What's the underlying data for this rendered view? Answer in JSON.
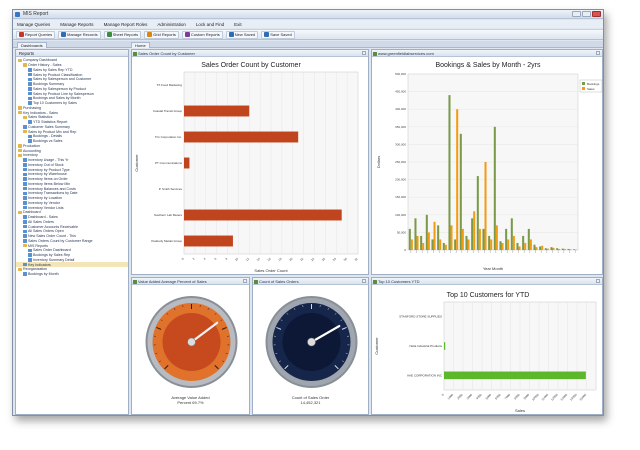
{
  "window": {
    "title": "MIS Report"
  },
  "menu": [
    "Manage Queries",
    "Manage Reports",
    "Manage Report Roles",
    "Administration",
    "Lock and Find",
    "Exit"
  ],
  "toolbar": [
    {
      "label": "Report Queries",
      "color": "#c0392b"
    },
    {
      "label": "Manage Records",
      "color": "#2e6db4"
    },
    {
      "label": "Sheet Reports",
      "color": "#3d8b3d"
    },
    {
      "label": "Grid Reports",
      "color": "#d68910"
    },
    {
      "label": "Custom Reports",
      "color": "#7d3c98"
    },
    {
      "label": "New Saved",
      "color": "#2e6db4"
    },
    {
      "label": "Save Saved",
      "color": "#2e6db4"
    }
  ],
  "tabs": {
    "left": "Dashboards",
    "main": "Home"
  },
  "sidebar": {
    "header": "Reports",
    "items": [
      {
        "label": "Company Dashboard",
        "level": 0,
        "icon": "folder"
      },
      {
        "label": "Order History - Sales",
        "level": 1,
        "icon": "folder"
      },
      {
        "label": "Sales by Sales Rep YTD",
        "level": 2,
        "icon": "report"
      },
      {
        "label": "Sales by Product Classification",
        "level": 2,
        "icon": "report"
      },
      {
        "label": "Sales by Salesperson and Customer",
        "level": 2,
        "icon": "report"
      },
      {
        "label": "Bookings Summary",
        "level": 2,
        "icon": "report"
      },
      {
        "label": "Sales by Salesperson by Product",
        "level": 2,
        "icon": "report"
      },
      {
        "label": "Sales by Product Line by Salesperson",
        "level": 2,
        "icon": "report"
      },
      {
        "label": "Bookings and Sales by Month",
        "level": 2,
        "icon": "report"
      },
      {
        "label": "Top 10 Customers by Sales",
        "level": 2,
        "icon": "report"
      },
      {
        "label": "Purchasing",
        "level": 0,
        "icon": "folder"
      },
      {
        "label": "Key Indicators - Sales",
        "level": 0,
        "icon": "folder"
      },
      {
        "label": "Sales Statistics",
        "level": 1,
        "icon": "folder"
      },
      {
        "label": "YTD Statistics Report",
        "level": 2,
        "icon": "report"
      },
      {
        "label": "Customer Sales Summary",
        "level": 1,
        "icon": "report"
      },
      {
        "label": "Sales by Product Mix and Rep",
        "level": 1,
        "icon": "folder"
      },
      {
        "label": "Bookings - Details",
        "level": 2,
        "icon": "report"
      },
      {
        "label": "Bookings vs Sales",
        "level": 2,
        "icon": "report"
      },
      {
        "label": "Production",
        "level": 0,
        "icon": "folder"
      },
      {
        "label": "Accounting",
        "level": 0,
        "icon": "folder"
      },
      {
        "label": "Inventory",
        "level": 0,
        "icon": "folder"
      },
      {
        "label": "Inventory Usage - This Yr",
        "level": 1,
        "icon": "report"
      },
      {
        "label": "Inventory Out of Stock",
        "level": 1,
        "icon": "report"
      },
      {
        "label": "Inventory by Product Type",
        "level": 1,
        "icon": "report"
      },
      {
        "label": "Inventory by Warehouse",
        "level": 1,
        "icon": "report"
      },
      {
        "label": "Inventory Items on Order",
        "level": 1,
        "icon": "report"
      },
      {
        "label": "Inventory Items Below Min",
        "level": 1,
        "icon": "report"
      },
      {
        "label": "Inventory Balances and Costs",
        "level": 1,
        "icon": "report"
      },
      {
        "label": "Inventory Transactions by Date",
        "level": 1,
        "icon": "report"
      },
      {
        "label": "Inventory by Location",
        "level": 1,
        "icon": "report"
      },
      {
        "label": "Inventory by Vendor",
        "level": 1,
        "icon": "report"
      },
      {
        "label": "Inventory Vendor Lists",
        "level": 1,
        "icon": "report"
      },
      {
        "label": "Dashboard",
        "level": 0,
        "icon": "folder"
      },
      {
        "label": "Dashboard - Sales",
        "level": 1,
        "icon": "report"
      },
      {
        "label": "All Sales Orders",
        "level": 1,
        "icon": "report"
      },
      {
        "label": "Customer Accounts Receivable",
        "level": 1,
        "icon": "report"
      },
      {
        "label": "All Sales Orders Open",
        "level": 1,
        "icon": "report"
      },
      {
        "label": "New Sales Order Count - This",
        "level": 1,
        "icon": "report"
      },
      {
        "label": "Sales Orders Count by Customer Range",
        "level": 1,
        "icon": "report"
      },
      {
        "label": "MIS Reports",
        "level": 1,
        "icon": "folder"
      },
      {
        "label": "Sales Order Dashboard",
        "level": 2,
        "icon": "report"
      },
      {
        "label": "Bookings by Sales Rep",
        "level": 2,
        "icon": "report"
      },
      {
        "label": "Inventory Summary Detail",
        "level": 2,
        "icon": "report"
      },
      {
        "label": "Key Indicators",
        "level": 1,
        "icon": "report",
        "selected": true
      },
      {
        "label": "Reorganization",
        "level": 0,
        "icon": "folder"
      },
      {
        "label": "Bookings by Month",
        "level": 1,
        "icon": "report"
      }
    ]
  },
  "panels": {
    "orders": {
      "header": "Sales Order Count by Customer",
      "chart_data": {
        "type": "bar",
        "orientation": "horizontal",
        "title": "Sales Order Count by Customer",
        "xlabel": "Sales Order Count",
        "ylabel": "Customer",
        "categories": [
          "TX Food Marketing",
          "Coastal Transit Group",
          "Trix Corporation Inc.",
          "PT Communications",
          "P. Smith Services",
          "Southern Lab Meters",
          "Peabody Metals Group"
        ],
        "values": [
          0,
          12,
          21,
          1,
          0,
          29,
          9
        ],
        "xlim": [
          0,
          32
        ],
        "color": "#c0451e"
      }
    },
    "bookings": {
      "header": "www.greenfieldlabservices.com",
      "chart_data": {
        "type": "bar",
        "title": "Bookings & Sales by Month - 2yrs",
        "xlabel": "Year Month",
        "ylabel": "Dollars",
        "yticks": [
          "0",
          "50,000",
          "100,000",
          "150,000",
          "200,000",
          "250,000",
          "300,000",
          "350,000",
          "400,000",
          "450,000",
          "500,000"
        ],
        "ylim": [
          0,
          500000
        ],
        "legend": "top-right",
        "series": [
          {
            "name": "Bookings",
            "color": "#7a9a4a",
            "values": [
              60000,
              90000,
              40000,
              100000,
              30000,
              70000,
              20000,
              440000,
              30000,
              330000,
              40000,
              90000,
              210000,
              60000,
              40000,
              350000,
              25000,
              60000,
              90000,
              20000,
              40000,
              60000,
              15000,
              10000,
              5000,
              8000,
              5000,
              4000,
              3000,
              2000
            ]
          },
          {
            "name": "Sales",
            "color": "#f39c12",
            "values": [
              30000,
              40000,
              20000,
              50000,
              80000,
              30000,
              15000,
              70000,
              400000,
              60000,
              30000,
              110000,
              60000,
              250000,
              30000,
              70000,
              20000,
              30000,
              40000,
              10000,
              20000,
              30000,
              8000,
              12000,
              4000,
              6000,
              3000,
              3000,
              2000,
              1000
            ]
          }
        ]
      }
    },
    "gauge1": {
      "header": "Value Added Average Percent of Sales",
      "caption_lines": [
        "Average Value Added",
        "Percent 69.7%"
      ],
      "value": 69.7,
      "range": [
        0,
        100
      ]
    },
    "gauge2": {
      "header": "Count of Sales Orders",
      "caption_lines": [
        "Count of Sales Order",
        "14,452,321"
      ],
      "value": 14452321,
      "range": [
        0,
        20000000
      ]
    },
    "top10": {
      "header": "Top 10 Customers YTD",
      "chart_data": {
        "type": "bar",
        "orientation": "horizontal",
        "title": "Top 10 Customers for YTD",
        "xlabel": "Sales",
        "ylabel": "Customer",
        "categories": [
          "STANFORD STORE SUPPLIES",
          "Nelia Industrial Products",
          "AAE CORPORATION INC"
        ],
        "values": [
          0,
          120,
          14000
        ],
        "xticks": [
          "0",
          "1000",
          "2000",
          "3000",
          "4000",
          "5000",
          "6000",
          "7000",
          "8000",
          "9000",
          "10000",
          "11000",
          "12000",
          "13000",
          "14000",
          "15000"
        ],
        "xlim": [
          0,
          15000
        ],
        "color": "#5cb82a"
      }
    }
  }
}
